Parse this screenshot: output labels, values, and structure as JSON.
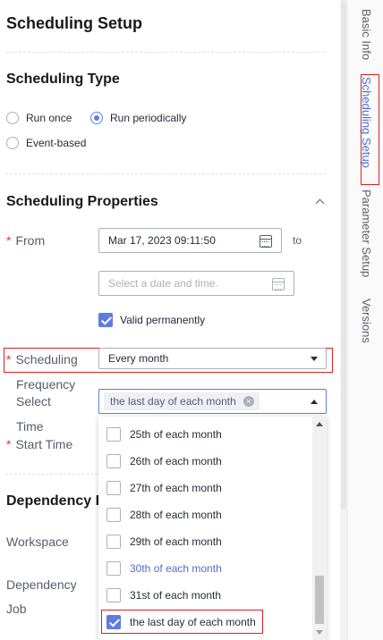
{
  "page": {
    "title": "Scheduling Setup"
  },
  "side_tabs": [
    {
      "label": "Basic Info"
    },
    {
      "label": "Scheduling Setup"
    },
    {
      "label": "Parameter Setup"
    },
    {
      "label": "Versions"
    }
  ],
  "scheduling_type": {
    "heading": "Scheduling Type",
    "options": [
      {
        "label": "Run once",
        "selected": false
      },
      {
        "label": "Run periodically",
        "selected": true
      },
      {
        "label": "Event-based",
        "selected": false
      }
    ]
  },
  "scheduling_properties": {
    "heading": "Scheduling Properties",
    "required_mark": "*",
    "from": {
      "label": "From",
      "value": "Mar 17, 2023 09:11:50",
      "to_label": "to",
      "end_placeholder": "Select a date and time.",
      "valid_permanently_label": "Valid permanently",
      "valid_permanently_checked": true
    },
    "scheduling": {
      "label": "Scheduling",
      "value": "Every month"
    },
    "frequency": {
      "label_line1": "Frequency",
      "label_line2": "Select",
      "tag": "the last day of each month"
    },
    "start_time": {
      "label_line1": "Time",
      "label_line2": "Start Time"
    }
  },
  "dependency": {
    "heading": "Dependency P",
    "workspace_label": "Workspace",
    "dependency_label": "Dependency",
    "job_label": "Job"
  },
  "frequency_dropdown": {
    "items": [
      {
        "label": "25th of each month",
        "checked": false
      },
      {
        "label": "26th of each month",
        "checked": false
      },
      {
        "label": "27th of each month",
        "checked": false
      },
      {
        "label": "28th of each month",
        "checked": false
      },
      {
        "label": "29th of each month",
        "checked": false
      },
      {
        "label": "30th of each month",
        "checked": false,
        "hover": true
      },
      {
        "label": "31st of each month",
        "checked": false
      },
      {
        "label": "the last day of each month",
        "checked": true
      }
    ]
  },
  "colors": {
    "accent": "#5e7ce0",
    "active_text": "#526ecc",
    "highlight_box": "#e02020",
    "required": "#f23030"
  },
  "icons": {
    "from_picker": "calendar-icon",
    "end_picker": "calendar-icon",
    "collapse": "chevron-up-icon",
    "scheduling_select": "caret-down-icon",
    "frequency_select": "caret-up-icon",
    "tag_remove": "close-icon"
  }
}
